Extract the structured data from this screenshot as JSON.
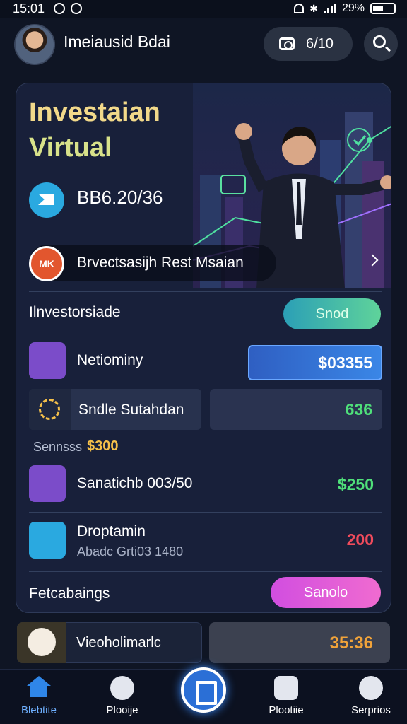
{
  "status_bar": {
    "time": "15:01",
    "battery_text": "29%"
  },
  "header": {
    "username": "Imeiausid Bdai",
    "pill_label": "6/10"
  },
  "hero": {
    "title_line1": "Investaian",
    "title_line2": "Virtual",
    "stat_value": "BB6.20/36"
  },
  "banner": {
    "icon_text": "MK",
    "text": "Brvectsasijh Rest Msaian"
  },
  "sections": {
    "investors_label": "Ilnvestorsiade",
    "investors_button": "Snod",
    "footer_label": "Fetcabaings",
    "footer_button": "Sanolo"
  },
  "rows": [
    {
      "label": "Netiominy",
      "value": "$03355"
    },
    {
      "label": "Sndle Sutahdan",
      "value": "636"
    },
    {
      "label": "Sanatichb 003/50",
      "value": "$250"
    },
    {
      "label": "Droptamin",
      "sublabel": "Abadc Grti03 1480",
      "value": "200"
    }
  ],
  "inline_note": {
    "label": "Sennsss",
    "value": "$300"
  },
  "bottom_row": {
    "label": "Vieoholimarlc",
    "value": "35:36"
  },
  "nav": {
    "items": [
      "Blebtite",
      "Plooije",
      "Plootiie",
      "Serprios"
    ]
  },
  "colors": {
    "accent_blue": "#2f86e8",
    "teal_button": "#33c9b5",
    "pink_button": "#e04cd8",
    "green": "#4fe07a",
    "red": "#ef4b5c",
    "gold": "#f5c04a",
    "orange": "#f1a33a"
  }
}
